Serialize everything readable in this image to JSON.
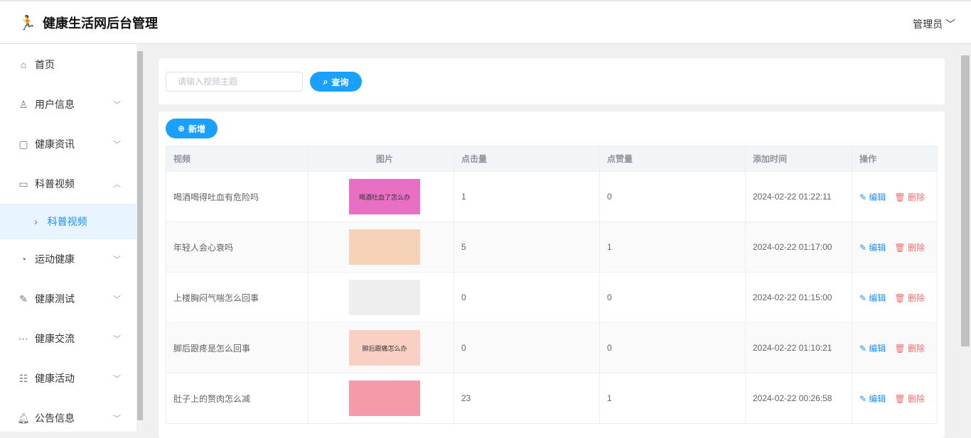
{
  "header": {
    "title": "健康生活网后台管理",
    "user": "管理员"
  },
  "sidebar": {
    "items": [
      {
        "label": "首页",
        "icon": "home-icon"
      },
      {
        "label": "用户信息",
        "icon": "user-icon"
      },
      {
        "label": "健康资讯",
        "icon": "news-icon"
      },
      {
        "label": "科普视频",
        "icon": "video-icon"
      },
      {
        "label": "运动健康",
        "icon": "sport-icon"
      },
      {
        "label": "健康测试",
        "icon": "edit-icon"
      },
      {
        "label": "健康交流",
        "icon": "chat-icon"
      },
      {
        "label": "健康活动",
        "icon": "activity-icon"
      },
      {
        "label": "公告信息",
        "icon": "bell-icon"
      }
    ],
    "active_sub": "科普视频"
  },
  "search": {
    "placeholder": "请输入视频主题",
    "button": "查询"
  },
  "toolbar": {
    "add": "新增"
  },
  "table": {
    "headers": [
      "视频",
      "图片",
      "点击量",
      "点赞量",
      "添加时间",
      "操作"
    ],
    "edit": "编辑",
    "delete": "删除",
    "rows": [
      {
        "title": "喝酒喝得吐血有危险吗",
        "thumb_text": "喝酒吐血了怎么办",
        "clicks": "1",
        "likes": "0",
        "time": "2024-02-22 01:22:11",
        "color": "#e86fc4"
      },
      {
        "title": "年轻人会心衰吗",
        "thumb_text": "",
        "clicks": "5",
        "likes": "1",
        "time": "2024-02-22 01:17:00",
        "color": "#f6d2b8"
      },
      {
        "title": "上楼胸闷气喘怎么回事",
        "thumb_text": "",
        "clicks": "0",
        "likes": "0",
        "time": "2024-02-22 01:15:00",
        "color": "#eeeeee"
      },
      {
        "title": "脚后跟疼是怎么回事",
        "thumb_text": "脚后跟痛怎么办",
        "clicks": "0",
        "likes": "0",
        "time": "2024-02-22 01:10:21",
        "color": "#fbd0c4"
      },
      {
        "title": "肚子上的赘肉怎么减",
        "thumb_text": "",
        "clicks": "23",
        "likes": "1",
        "time": "2024-02-22 00:26:58",
        "color": "#f49aa8"
      }
    ]
  }
}
